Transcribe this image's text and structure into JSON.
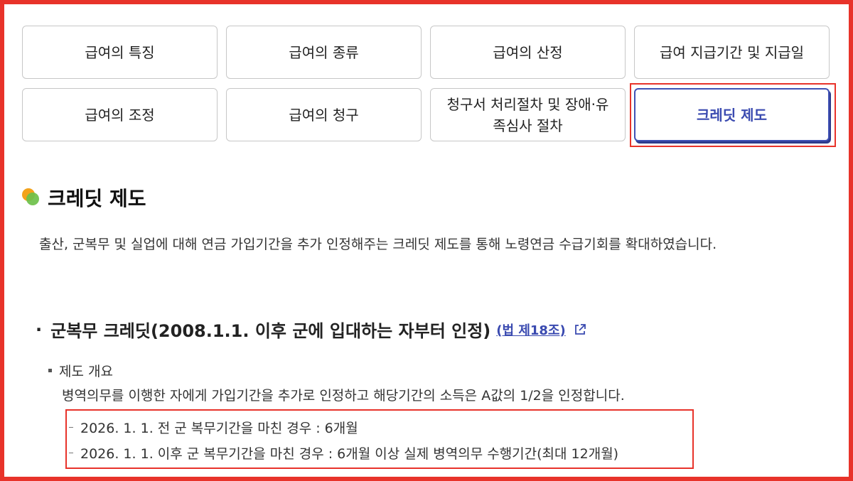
{
  "tabs": [
    {
      "label": "급여의 특징",
      "active": false
    },
    {
      "label": "급여의 종류",
      "active": false
    },
    {
      "label": "급여의 산정",
      "active": false
    },
    {
      "label": "급여 지급기간 및 지급일",
      "active": false
    },
    {
      "label": "급여의 조정",
      "active": false
    },
    {
      "label": "급여의 청구",
      "active": false
    },
    {
      "label": "청구서 처리절차 및 장애·유족심사 절차",
      "active": false
    },
    {
      "label": "크레딧 제도",
      "active": true
    }
  ],
  "section": {
    "title": "크레딧 제도",
    "intro": "출산, 군복무 및 실업에 대해 연금 가입기간을 추가 인정해주는 크레딧 제도를 통해 노령연금 수급기회를 확대하였습니다."
  },
  "subsection": {
    "bullet": "·",
    "title": "군복무 크레딧(2008.1.1. 이후 군에 입대하는 자부터 인정)",
    "law_link": "(법 제18조)",
    "overview_label": "제도 개요",
    "overview_desc": "병역의무를 이행한 자에게 가입기간을 추가로 인정하고 해당기간의 소득은 A값의 1/2을 인정합니다.",
    "details": [
      "2026. 1. 1. 전 군 복무기간을 마친 경우 : 6개월",
      "2026. 1. 1. 이후 군 복무기간을 마친 경우 : 6개월 이상 실제 병역의무 수행기간(최대 12개월)"
    ]
  },
  "colors": {
    "accent": "#3a4ab0",
    "highlight": "#e8332a",
    "dot_orange": "#f2a21b",
    "dot_green": "#6cc04a"
  }
}
